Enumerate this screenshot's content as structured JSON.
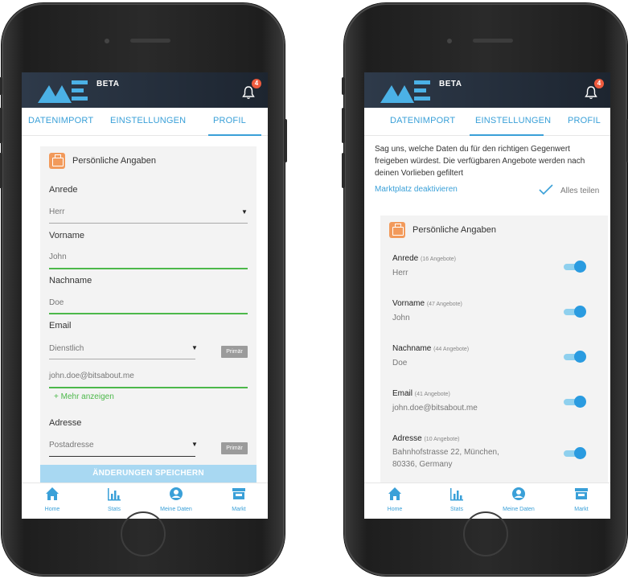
{
  "app": {
    "beta": "BETA",
    "notification_count": "4"
  },
  "tabs": [
    "DATENIMPORT",
    "EINSTELLUNGEN",
    "PROFIL"
  ],
  "left": {
    "card_title": "Persönliche Angaben",
    "anrede_label": "Anrede",
    "anrede_value": "Herr",
    "vorname_label": "Vorname",
    "vorname_value": "John",
    "nachname_label": "Nachname",
    "nachname_value": "Doe",
    "email_label": "Email",
    "email_type": "Dienstlich",
    "primar": "Primär",
    "email_value": "john.doe@bitsabout.me",
    "more": "+ Mehr anzeigen",
    "adresse_label": "Adresse",
    "adresse_type": "Postadresse",
    "save_label": "ÄNDERUNGEN SPEICHERN"
  },
  "right": {
    "intro": "Sag uns, welche Daten du für den richtigen Gegenwert freigeben würdest. Die verfügbaren Angebote werden nach deinen Vorlieben gefiltert",
    "marketplace_link": "Marktplatz deaktivieren",
    "share_all": "Alles teilen",
    "card_title": "Persönliche Angaben",
    "fields": [
      {
        "label": "Anrede",
        "count": "(16 Angebote)",
        "value": "Herr",
        "enabled": true
      },
      {
        "label": "Vorname",
        "count": "(47 Angebote)",
        "value": "John",
        "enabled": true
      },
      {
        "label": "Nachname",
        "count": "(44 Angebote)",
        "value": "Doe",
        "enabled": true
      },
      {
        "label": "Email",
        "count": "(41 Angebote)",
        "value": "john.doe@bitsabout.me",
        "enabled": true
      },
      {
        "label": "Adresse",
        "count": "(10 Angebote)",
        "value": "Bahnhofstrasse 22, München, 80336, Germany",
        "enabled": true
      }
    ]
  },
  "nav": [
    "Home",
    "Stats",
    "Meine Daten",
    "Markt"
  ],
  "colors": {
    "accent": "#3aa0d8",
    "green": "#4cb84a",
    "badge": "#ef5b3e",
    "icon_orange": "#f29a5b"
  }
}
